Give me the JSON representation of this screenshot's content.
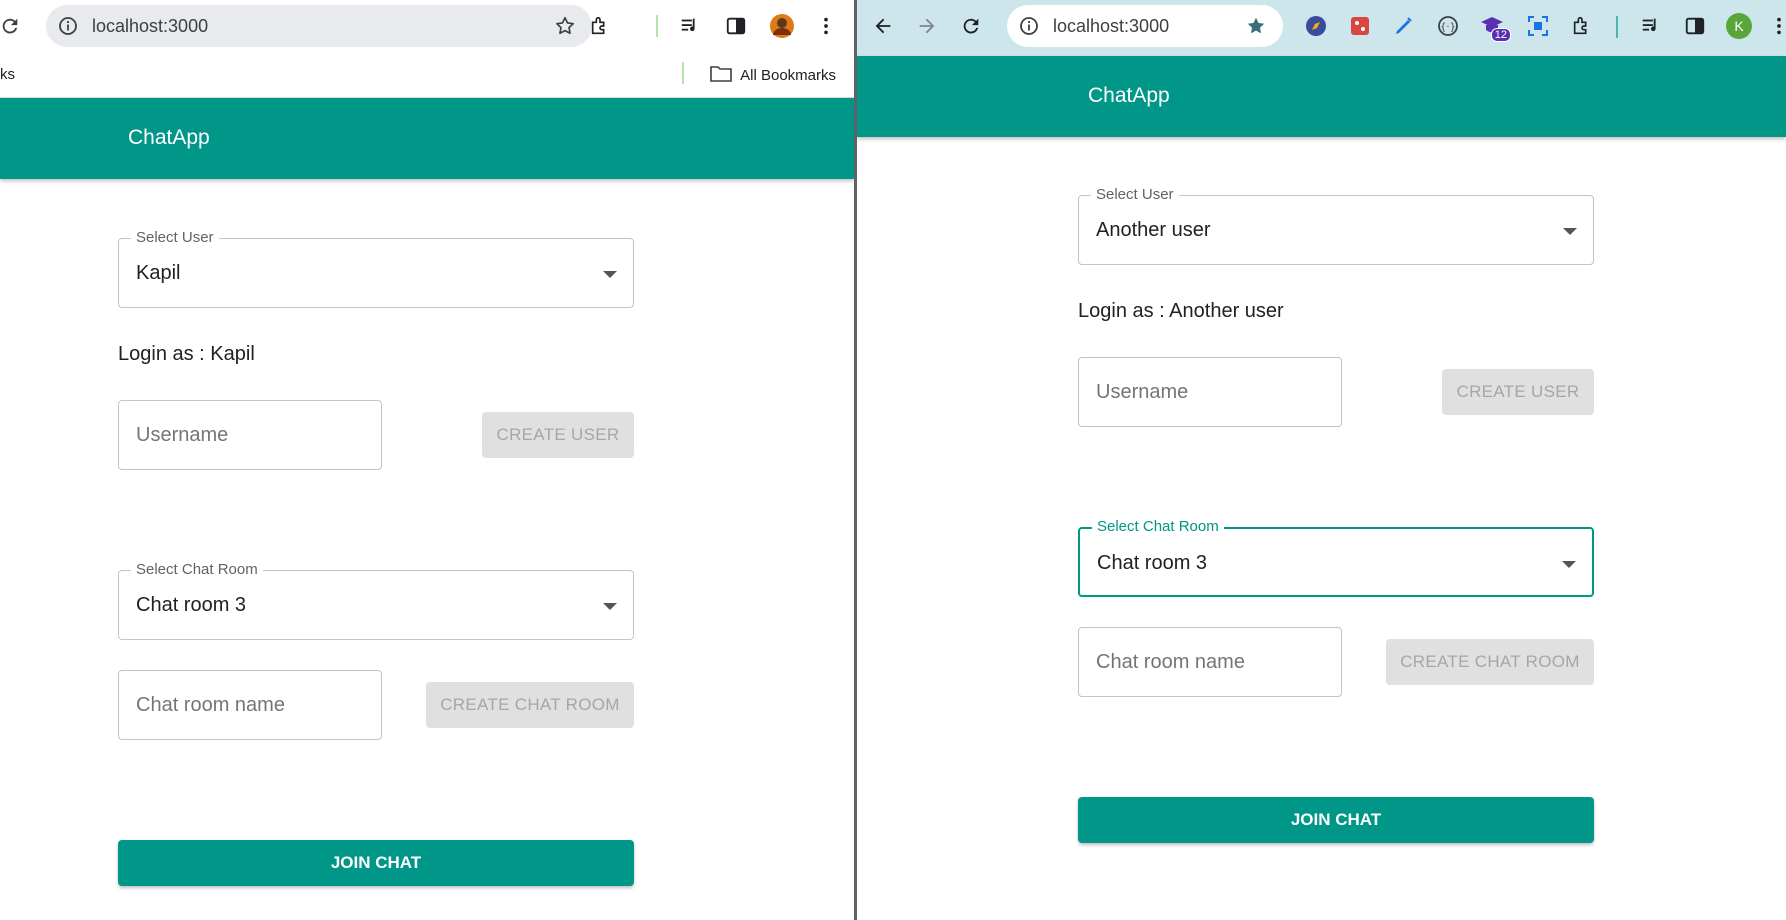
{
  "left": {
    "browser": {
      "url": "localhost:3000",
      "bookmarks_left": "ks",
      "bookmarks_all": "All Bookmarks"
    },
    "app": {
      "title": "ChatApp",
      "select_user": {
        "label": "Select User",
        "value": "Kapil"
      },
      "login_as": "Login as : Kapil",
      "username_placeholder": "Username",
      "create_user": "CREATE USER",
      "select_room": {
        "label": "Select Chat Room",
        "value": "Chat room 3"
      },
      "room_placeholder": "Chat room name",
      "create_room": "CREATE CHAT ROOM",
      "join": "JOIN CHAT"
    }
  },
  "right": {
    "browser": {
      "url": "localhost:3000",
      "badge_count": "12",
      "profile_letter": "K"
    },
    "app": {
      "title": "ChatApp",
      "select_user": {
        "label": "Select User",
        "value": "Another user"
      },
      "login_as": "Login as : Another user",
      "username_placeholder": "Username",
      "create_user": "CREATE USER",
      "select_room": {
        "label": "Select Chat Room",
        "value": "Chat room 3"
      },
      "room_placeholder": "Chat room name",
      "create_room": "CREATE CHAT ROOM",
      "join": "JOIN CHAT"
    }
  },
  "colors": {
    "primary": "#009688",
    "disabled_bg": "#e0e0e0",
    "disabled_text": "#a6a6a6",
    "right_toolbar": "#cde6ec"
  }
}
